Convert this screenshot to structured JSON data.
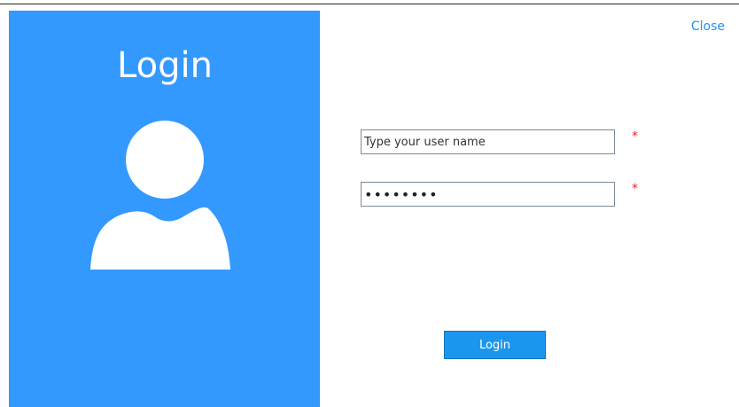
{
  "panel": {
    "title": "Login",
    "accent_color": "#3399ff",
    "avatar_icon": "user-silhouette-icon"
  },
  "header": {
    "close_label": "Close",
    "close_color": "#1e90ff"
  },
  "form": {
    "username": {
      "value": "",
      "placeholder": "Type your user name",
      "required_marker": "*"
    },
    "password": {
      "value": "••••••••",
      "required_marker": "*"
    },
    "submit_label": "Login",
    "required_color": "#e8232a"
  }
}
